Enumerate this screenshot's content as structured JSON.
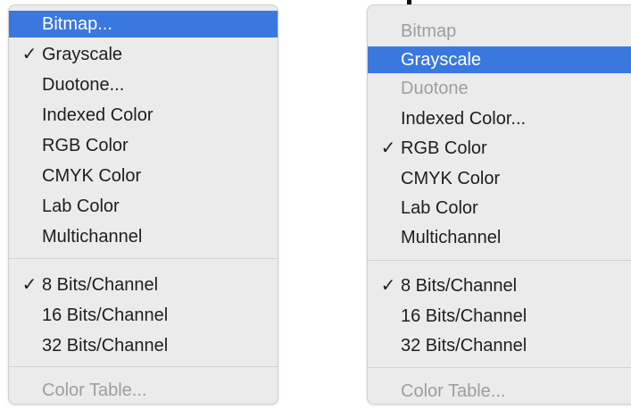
{
  "colors": {
    "menu_background": "#ebebeb",
    "selection": "#3a78e0",
    "text": "#1e1e1e",
    "disabled_text": "#9e9e9e",
    "separator": "#d2d2d2"
  },
  "left_menu": {
    "items": [
      {
        "label": "Bitmap...",
        "checked": false,
        "state": "highlighted"
      },
      {
        "label": "Grayscale",
        "checked": true,
        "state": "normal"
      },
      {
        "label": "Duotone...",
        "checked": false,
        "state": "normal"
      },
      {
        "label": "Indexed Color",
        "checked": false,
        "state": "normal"
      },
      {
        "label": "RGB Color",
        "checked": false,
        "state": "normal"
      },
      {
        "label": "CMYK Color",
        "checked": false,
        "state": "normal"
      },
      {
        "label": "Lab Color",
        "checked": false,
        "state": "normal"
      },
      {
        "label": "Multichannel",
        "checked": false,
        "state": "normal"
      },
      {
        "label": "8 Bits/Channel",
        "checked": true,
        "state": "normal"
      },
      {
        "label": "16 Bits/Channel",
        "checked": false,
        "state": "normal"
      },
      {
        "label": "32 Bits/Channel",
        "checked": false,
        "state": "normal"
      },
      {
        "label": "Color Table...",
        "checked": false,
        "state": "disabled"
      }
    ],
    "check_glyph": "✓"
  },
  "right_menu": {
    "items": [
      {
        "label": "Bitmap",
        "checked": false,
        "state": "disabled"
      },
      {
        "label": "Grayscale",
        "checked": false,
        "state": "highlighted"
      },
      {
        "label": "Duotone",
        "checked": false,
        "state": "disabled"
      },
      {
        "label": "Indexed Color...",
        "checked": false,
        "state": "normal"
      },
      {
        "label": "RGB Color",
        "checked": true,
        "state": "normal"
      },
      {
        "label": "CMYK Color",
        "checked": false,
        "state": "normal"
      },
      {
        "label": "Lab Color",
        "checked": false,
        "state": "normal"
      },
      {
        "label": "Multichannel",
        "checked": false,
        "state": "normal"
      },
      {
        "label": "8 Bits/Channel",
        "checked": true,
        "state": "normal"
      },
      {
        "label": "16 Bits/Channel",
        "checked": false,
        "state": "normal"
      },
      {
        "label": "32 Bits/Channel",
        "checked": false,
        "state": "normal"
      },
      {
        "label": "Color Table...",
        "checked": false,
        "state": "disabled"
      }
    ],
    "check_glyph": "✓"
  }
}
